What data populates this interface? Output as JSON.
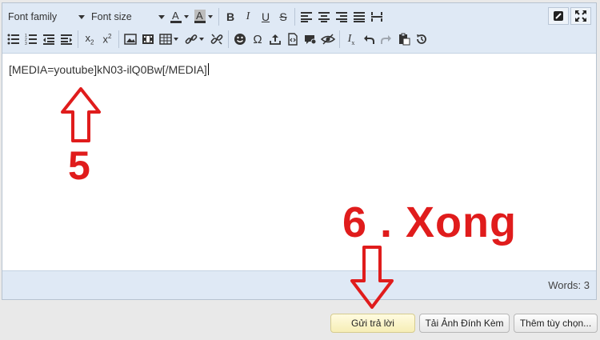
{
  "toolbar": {
    "font_family": "Font family",
    "font_size": "Font size",
    "row1_icons": [
      "text-color-icon",
      "highlight-color-icon",
      "bold-icon",
      "italic-icon",
      "underline-icon",
      "strikethrough-icon",
      "align-left-icon",
      "align-center-icon",
      "align-right-icon",
      "align-justify-icon",
      "horizontal-rule-icon"
    ],
    "row2_icons": [
      "bullet-list-icon",
      "numbered-list-icon",
      "outdent-icon",
      "indent-icon",
      "subscript-icon",
      "superscript-icon",
      "insert-image-icon",
      "insert-media-icon",
      "table-icon",
      "link-icon",
      "unlink-icon",
      "smiley-icon",
      "special-char-icon",
      "upload-icon",
      "code-icon",
      "quote-icon",
      "hide-icon",
      "remove-format-icon",
      "undo-icon",
      "redo-icon",
      "paste-icon",
      "restore-draft-icon"
    ],
    "right_icons": [
      "toggle-editor-icon",
      "fullscreen-icon"
    ]
  },
  "editor": {
    "content": "[MEDIA=youtube]kN03-ilQ0Bw[/MEDIA]"
  },
  "status": {
    "words": "Words: 3"
  },
  "annotations": {
    "step5": "5",
    "step6": "6 . Xong",
    "color": "#e01c1c"
  },
  "buttons": {
    "reply": "Gửi trả lời",
    "upload": "Tải Ảnh Đính Kèm",
    "more_options": "Thêm tùy chọn..."
  }
}
